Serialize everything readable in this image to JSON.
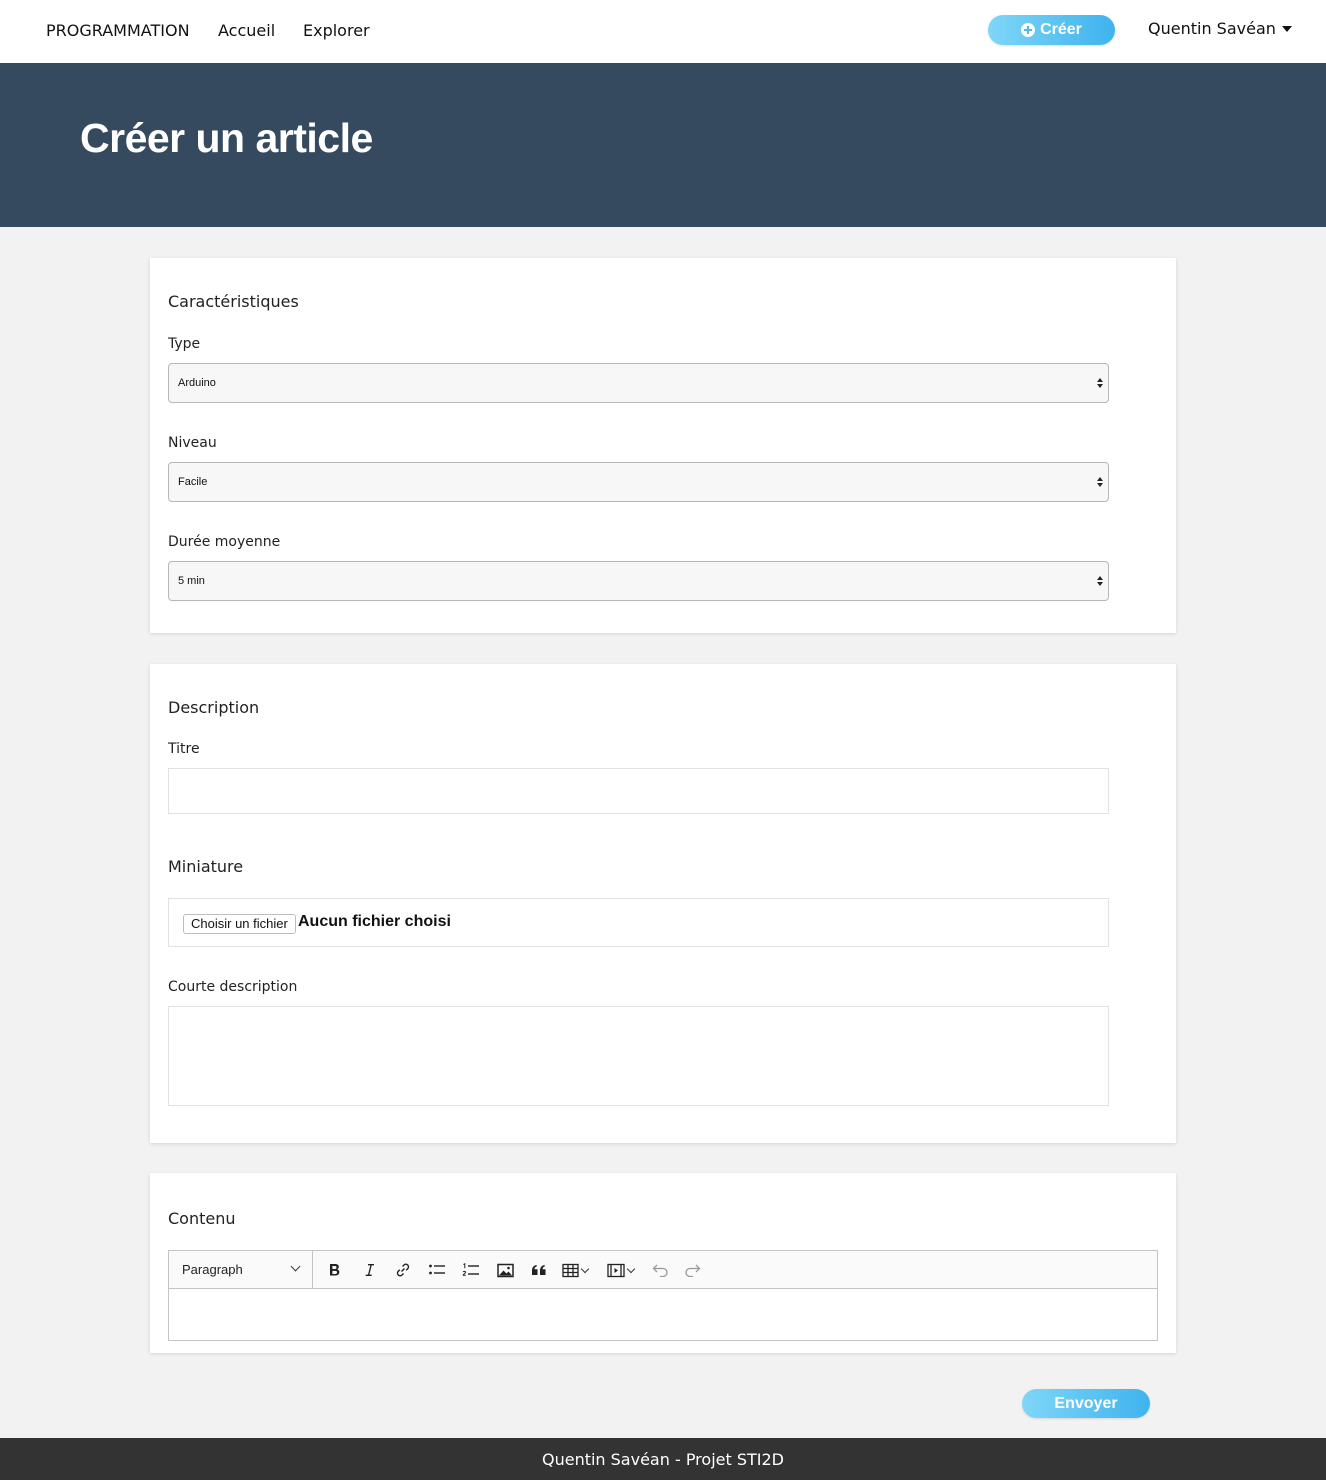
{
  "navbar": {
    "brand": "PROGRAMMATION",
    "links": [
      "Accueil",
      "Explorer"
    ],
    "create_button": "Créer",
    "user_name": "Quentin Savéan"
  },
  "hero": {
    "title": "Créer un article"
  },
  "characteristics": {
    "title": "Caractéristiques",
    "type": {
      "label": "Type",
      "value": "Arduino"
    },
    "level": {
      "label": "Niveau",
      "value": "Facile"
    },
    "duration": {
      "label": "Durée moyenne",
      "value": "5 min"
    }
  },
  "description": {
    "title": "Description",
    "title_field": {
      "label": "Titre",
      "value": ""
    },
    "thumbnail": {
      "label": "Miniature",
      "button": "Choisir un fichier",
      "status": "Aucun fichier choisi"
    },
    "short_description": {
      "label": "Courte description",
      "value": ""
    }
  },
  "content": {
    "title": "Contenu",
    "heading_select": "Paragraph",
    "toolbar_icons": [
      "bold-icon",
      "italic-icon",
      "link-icon",
      "bulleted-list-icon",
      "numbered-list-icon",
      "image-icon",
      "blockquote-icon",
      "table-icon",
      "media-icon",
      "undo-icon",
      "redo-icon"
    ]
  },
  "submit": {
    "label": "Envoyer"
  },
  "footer": {
    "text": "Quentin Savéan - Projet STI2D"
  },
  "colors": {
    "hero_bg": "#354a5f",
    "accent_gradient_start": "#7fd6f7",
    "accent_gradient_end": "#3fb3ee",
    "footer_bg": "#333333",
    "page_bg": "#f2f2f2"
  }
}
